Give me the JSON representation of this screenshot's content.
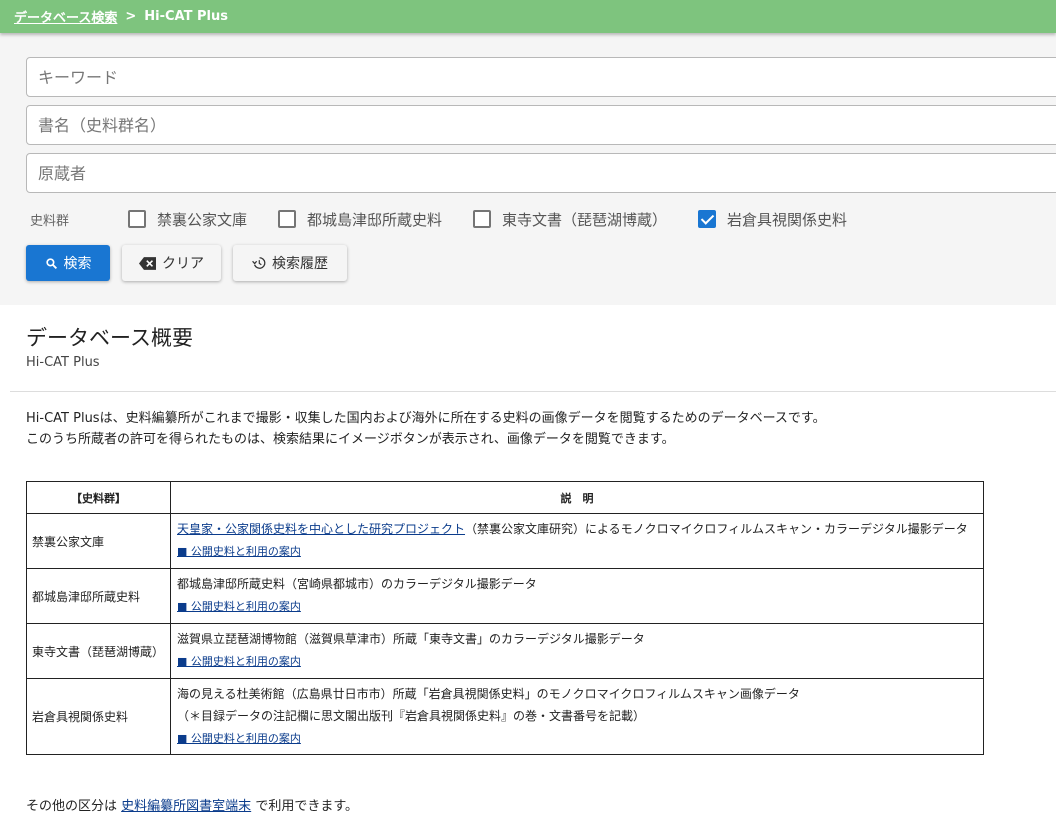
{
  "breadcrumb": {
    "parent": "データベース検索",
    "separator": ">",
    "current": "Hi-CAT Plus"
  },
  "search": {
    "keyword_placeholder": "キーワード",
    "title_placeholder": "書名（史料群名）",
    "owner_placeholder": "原蔵者"
  },
  "collections": {
    "label": "史料群",
    "items": [
      {
        "label": "禁裏公家文庫",
        "checked": false
      },
      {
        "label": "都城島津邸所蔵史料",
        "checked": false
      },
      {
        "label": "東寺文書（琵琶湖博蔵）",
        "checked": false
      },
      {
        "label": "岩倉具視関係史料",
        "checked": true
      }
    ]
  },
  "buttons": {
    "search": "検索",
    "clear": "クリア",
    "history": "検索履歴"
  },
  "overview": {
    "title": "データベース概要",
    "subtitle": "Hi-CAT Plus",
    "desc_line1": "Hi-CAT Plusは、史料編纂所がこれまで撮影・収集した国内および海外に所在する史料の画像データを閲覧するためのデータベースです。",
    "desc_line2": "このうち所蔵者の許可を得られたものは、検索結果にイメージボタンが表示され、画像データを閲覧できます。"
  },
  "table": {
    "header_collection": "【史料群】",
    "header_description": "説　明",
    "guide_link": "■ 公開史料と利用の案内",
    "rows": [
      {
        "name": "禁裏公家文庫",
        "link_text": "天皇家・公家関係史料を中心とした研究プロジェクト",
        "text": "（禁裏公家文庫研究）によるモノクロマイクロフィルムスキャン・カラーデジタル撮影データ"
      },
      {
        "name": "都城島津邸所蔵史料",
        "text": "都城島津邸所蔵史料（宮崎県都城市）のカラーデジタル撮影データ"
      },
      {
        "name": "東寺文書（琵琶湖博蔵）",
        "text": "滋賀県立琵琶湖博物館（滋賀県草津市）所蔵「東寺文書」のカラーデジタル撮影データ"
      },
      {
        "name": "岩倉具視関係史料",
        "text": "海の見える杜美術館（広島県廿日市市）所蔵「岩倉具視関係史料」のモノクロマイクロフィルムスキャン画像データ",
        "note": "（＊目録データの注記欄に思文閣出版刊『岩倉具視関係史料』の巻・文書番号を記載）"
      }
    ]
  },
  "footer": {
    "prefix": "その他の区分は",
    "link": "史料編纂所図書室端末",
    "suffix": "で利用できます。"
  },
  "colors": {
    "topbar": "#7ec47e",
    "primary_button": "#1976d2",
    "panel_bg": "#f5f5f5"
  },
  "icons": [
    "search-icon",
    "backspace-icon",
    "history-icon",
    "checkbox-icon"
  ]
}
